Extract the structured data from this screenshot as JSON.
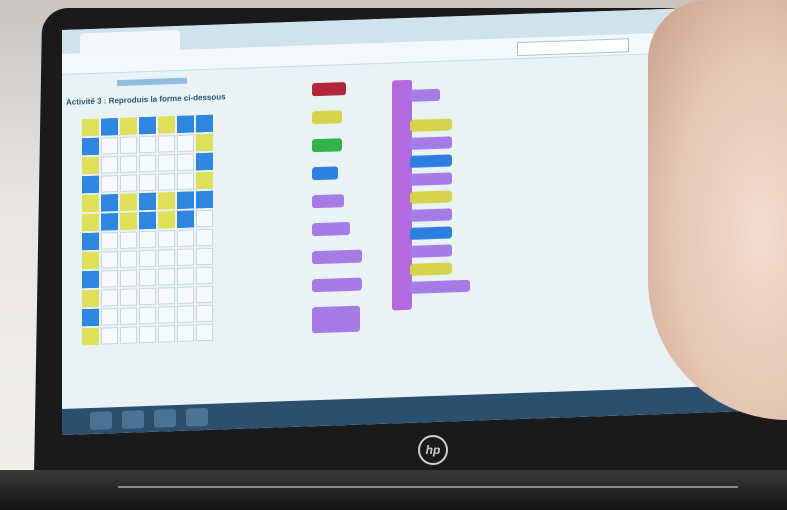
{
  "scene": {
    "description_label": "",
    "laptop_brand_mark": "hp"
  },
  "browser": {
    "tab_title": "",
    "url": "",
    "search_placeholder": ""
  },
  "activity": {
    "heading": "Activité 3 : Reproduis la forme ci-dessous"
  },
  "palette_blocks": [
    {
      "name": "block-red",
      "color": "#b3263a"
    },
    {
      "name": "block-yellow",
      "color": "#d6d34a"
    },
    {
      "name": "block-green",
      "color": "#33b24a"
    },
    {
      "name": "block-blue",
      "color": "#2e7fe0"
    },
    {
      "name": "block-purple-1",
      "color": "#a67be6"
    },
    {
      "name": "block-purple-2",
      "color": "#a67be6"
    },
    {
      "name": "block-purple-3",
      "color": "#a67be6"
    },
    {
      "name": "block-purple-4",
      "color": "#a67be6"
    },
    {
      "name": "block-loop",
      "color": "#a67be6"
    }
  ],
  "grid_pattern": [
    "ybybybb",
    "b.....y",
    "y.....b",
    "b.....y",
    "ybybybb",
    "ybybyb.",
    "b......",
    "y......",
    "b......",
    "y......",
    "b......",
    "y......"
  ],
  "colors": {
    "grid_blue": "#2e86e0",
    "grid_yellow": "#dfe05a",
    "stack_purple": "#b36adf"
  }
}
